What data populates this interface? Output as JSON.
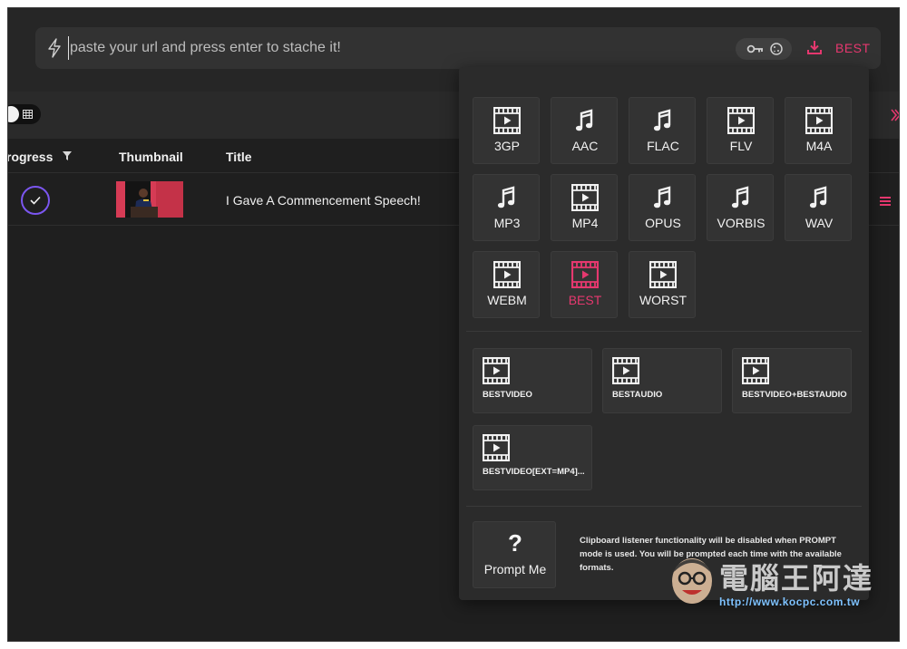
{
  "url_bar": {
    "placeholder": "paste your url and press enter to stache it!",
    "quality_label": "BEST"
  },
  "table": {
    "columns": [
      "rogress",
      "Thumbnail",
      "Title"
    ],
    "rows": [
      {
        "status": "completed",
        "title": "I Gave A Commencement Speech!"
      }
    ]
  },
  "format_panel": {
    "formats": [
      {
        "label": "3GP",
        "icon": "film-icon"
      },
      {
        "label": "AAC",
        "icon": "music-note-icon"
      },
      {
        "label": "FLAC",
        "icon": "music-note-icon"
      },
      {
        "label": "FLV",
        "icon": "film-icon"
      },
      {
        "label": "M4A",
        "icon": "film-icon"
      },
      {
        "label": "MP3",
        "icon": "music-note-icon"
      },
      {
        "label": "MP4",
        "icon": "film-icon"
      },
      {
        "label": "OPUS",
        "icon": "music-note-icon"
      },
      {
        "label": "VORBIS",
        "icon": "music-note-icon"
      },
      {
        "label": "WAV",
        "icon": "music-note-icon"
      },
      {
        "label": "WEBM",
        "icon": "film-icon"
      },
      {
        "label": "BEST",
        "icon": "film-icon",
        "selected": true
      },
      {
        "label": "WORST",
        "icon": "film-icon"
      }
    ],
    "combos": [
      {
        "label": "BESTVIDEO"
      },
      {
        "label": "BESTAUDIO"
      },
      {
        "label": "BESTVIDEO+BESTAUDIO"
      },
      {
        "label": "BESTVIDEO[EXT=MP4]..."
      }
    ],
    "prompt": {
      "symbol": "?",
      "label": "Prompt Me",
      "note": "Clipboard listener functionality will be disabled when PROMPT mode is used. You will be prompted each time with the available formats."
    }
  },
  "watermark": {
    "text": "電腦王阿達",
    "url": "http://www.kocpc.com.tw"
  },
  "colors": {
    "accent": "#e6386f",
    "progress_ring": "#7b56f0",
    "background": "#1f1f1f",
    "panel": "#2b2b2b"
  }
}
